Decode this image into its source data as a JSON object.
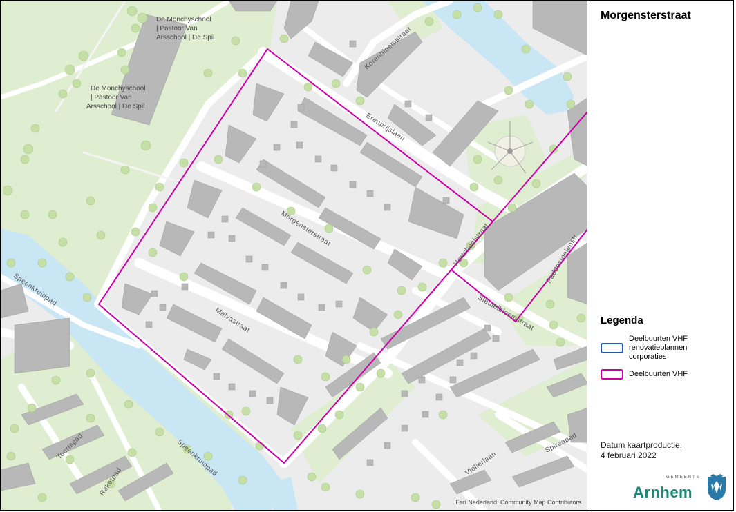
{
  "map": {
    "title": "Morgensterstraat",
    "attribution": "Esri Nederland, Community Map Contributors",
    "street_labels": {
      "korenbloemstraat": "Korenbloemstraat",
      "erenprijslaan": "Erenprijslaan",
      "morgensterstraat": "Morgensterstraat",
      "malvastraat": "Malvastraat",
      "speenkruidpad_1": "Speenkruidpad",
      "speenkruidpad_2": "Speenkruidpad",
      "sleutelbloemstraat": "Sleutelbloemstraat",
      "toortspad": "Toortspad",
      "raketpad": "Raketpad",
      "violierlaan": "Violierlaan",
      "spireapad": "Spireapad",
      "partial_road_1": "Hertshooistraat",
      "partial_road_2": "Paddestoelenstr"
    },
    "poi_labels": {
      "school_a_line1": "De Monchyschool",
      "school_a_line2": "| Pastoor Van",
      "school_a_line3": "Arsschool | De Spil",
      "school_b_line1": "De Monchyschool",
      "school_b_line2": "| Pastoor Van",
      "school_b_line3": "Arsschool | De Spil"
    },
    "colors": {
      "background": "#ececec",
      "green": "#dfedd0",
      "water": "#c9e6f5",
      "building": "#b8b8b8",
      "tree": "#c5dfa6",
      "road": "#ffffff",
      "boundary_vhf": "#cc00aa",
      "boundary_renovatie": "#1a5cb8"
    }
  },
  "legend": {
    "title": "Legenda",
    "items": [
      {
        "label": "Deelbuurten VHF renovatieplannen corporaties",
        "color": "#1a5cb8"
      },
      {
        "label": "Deelbuurten VHF",
        "color": "#cc00aa"
      }
    ]
  },
  "footer": {
    "date_label": "Datum kaartproductie:",
    "date_value": "4 februari 2022"
  },
  "logo": {
    "small_text": "GEMEENTE",
    "text": "Arnhem",
    "color": "#1a8a7a",
    "icon": "arnhem-crest-icon"
  }
}
